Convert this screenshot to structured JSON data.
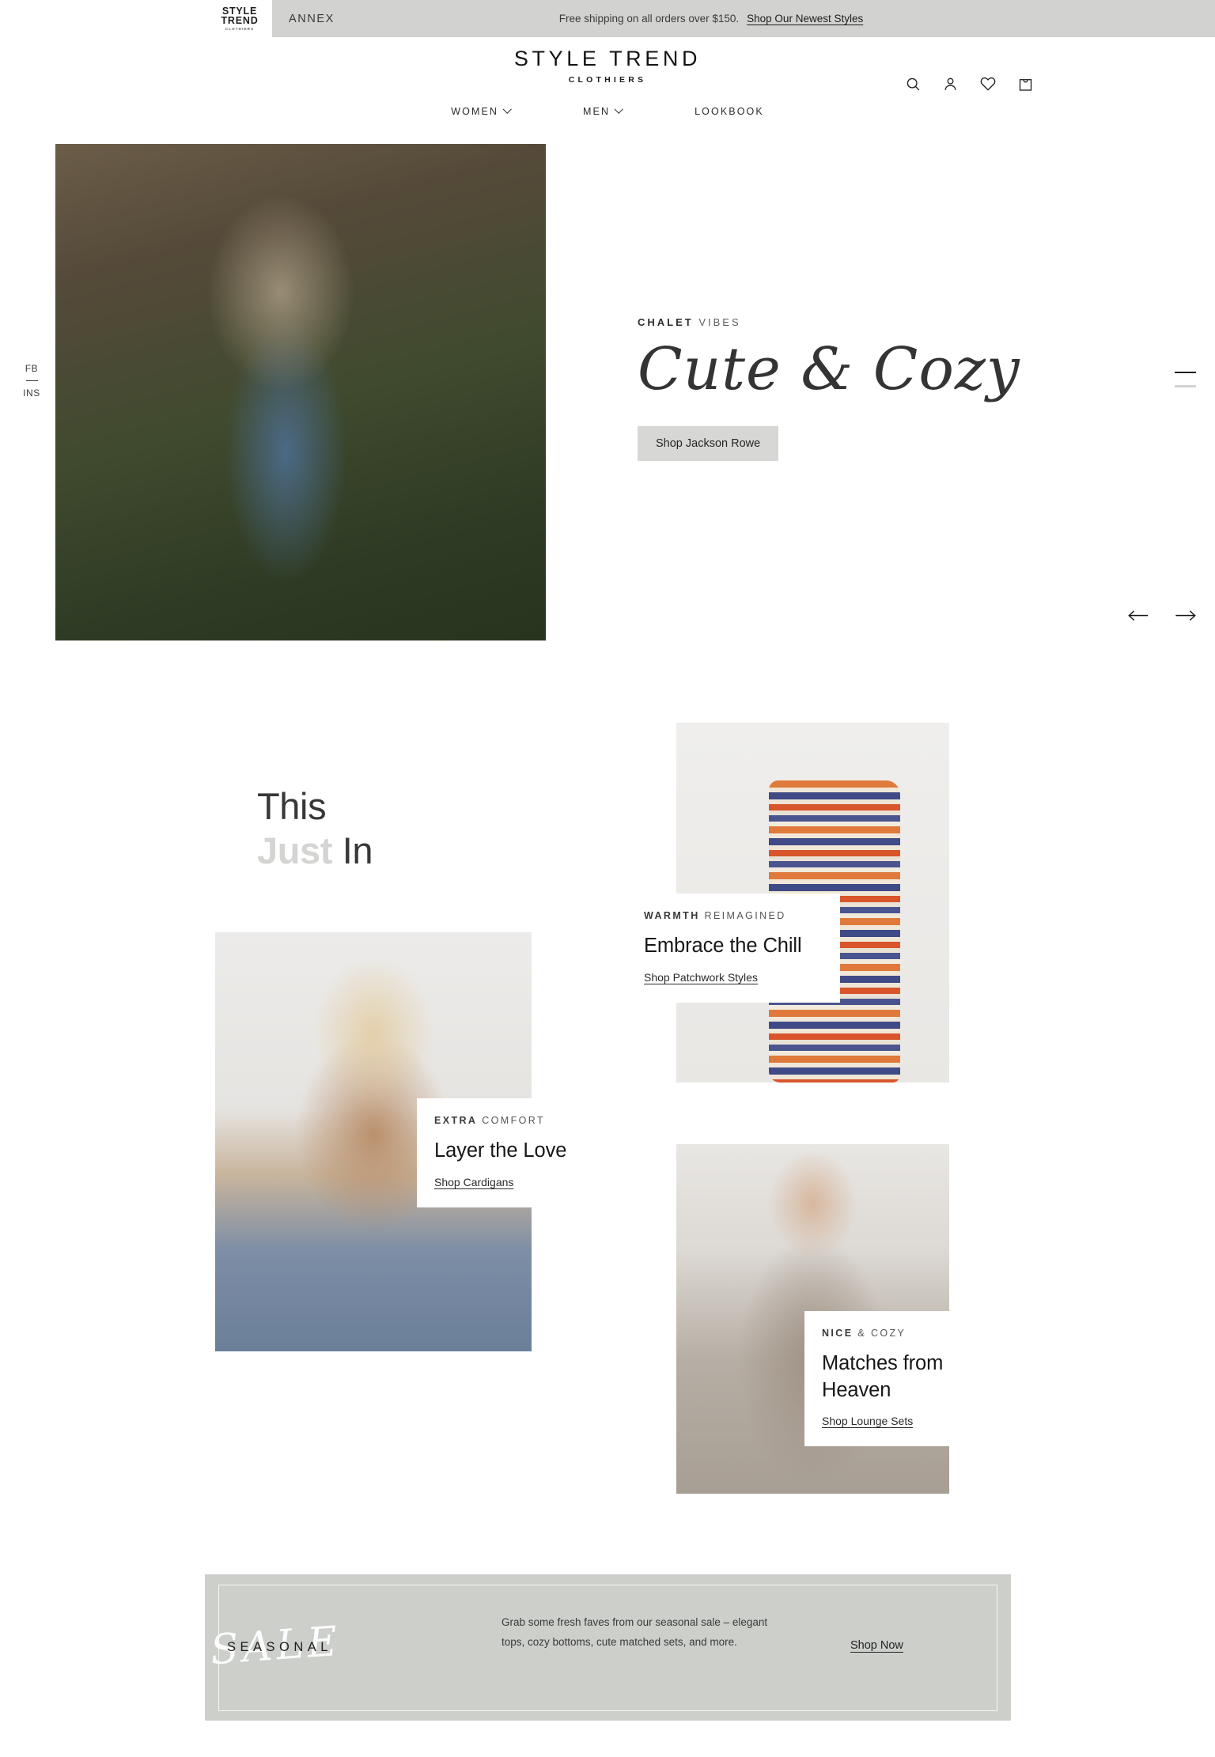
{
  "announcement": {
    "logo": {
      "line1": "STYLE",
      "line2": "TREND",
      "line3": "CLOTHIERS"
    },
    "annex_label": "ANNEX",
    "message": "Free shipping on all orders over $150.",
    "link": "Shop Our Newest Styles"
  },
  "header": {
    "brand_name": "STYLE TREND",
    "brand_sub": "CLOTHIERS",
    "icons": [
      "search-icon",
      "account-icon",
      "wishlist-heart-icon",
      "cart-bag-icon"
    ],
    "nav": [
      {
        "label": "WOMEN",
        "has_dropdown": true
      },
      {
        "label": "MEN",
        "has_dropdown": true
      },
      {
        "label": "LOOKBOOK",
        "has_dropdown": false
      }
    ]
  },
  "social_rail": {
    "facebook": "FB",
    "instagram": "INS"
  },
  "hero": {
    "eyebrow_bold": "CHALET",
    "eyebrow_light": "VIBES",
    "title": "Cute & Cozy",
    "button": "Shop Jackson Rowe",
    "slides": {
      "total": 2,
      "active": 1
    },
    "prev_label": "previous-slide",
    "next_label": "next-slide"
  },
  "just_in": {
    "line1": "This",
    "line2_muted": "Just",
    "line2_rest": "In"
  },
  "cards": [
    {
      "eyebrow_bold": "WARMTH",
      "eyebrow_light": "REIMAGINED",
      "title": "Embrace the Chill",
      "link": "Shop Patchwork Styles"
    },
    {
      "eyebrow_bold": "EXTRA",
      "eyebrow_light": "COMFORT",
      "title": "Layer the Love",
      "link": "Shop Cardigans"
    },
    {
      "eyebrow_bold": "NICE",
      "eyebrow_light": "& COZY",
      "title": "Matches from Heaven",
      "link": "Shop Lounge Sets"
    }
  ],
  "sale_banner": {
    "word": "SEASONAL",
    "script": "SALE",
    "body": "Grab some fresh faves from our seasonal sale – elegant tops, cozy bottoms, cute matched sets, and more.",
    "cta": "Shop Now"
  },
  "colors": {
    "announce_bg": "#d2d2d0",
    "hero_button_bg": "#d7d7d5",
    "sale_bg": "#cdcfcb",
    "muted_text": "#d4d4d2",
    "body_text": "#2b2b2b"
  }
}
